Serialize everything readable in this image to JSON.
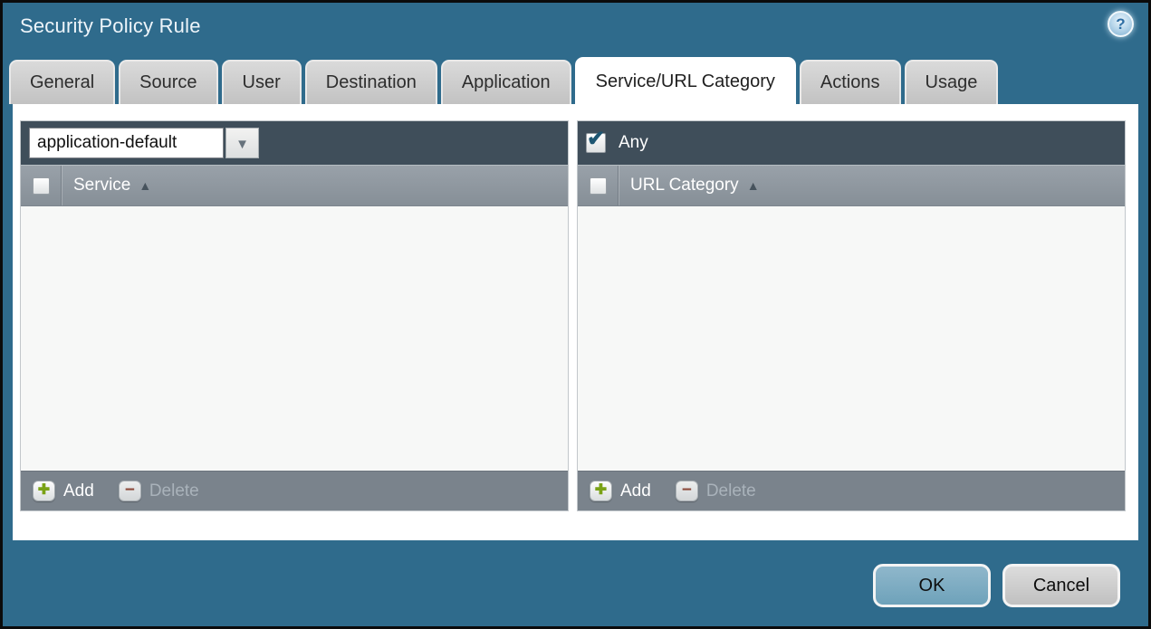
{
  "window": {
    "title": "Security Policy Rule"
  },
  "icons": {
    "help": "?",
    "check": "✔",
    "sort_asc": "▲",
    "caret_down": "▼",
    "add_plus": "✚",
    "delete_minus": "−"
  },
  "tabs": [
    {
      "label": "General",
      "active": false
    },
    {
      "label": "Source",
      "active": false
    },
    {
      "label": "User",
      "active": false
    },
    {
      "label": "Destination",
      "active": false
    },
    {
      "label": "Application",
      "active": false
    },
    {
      "label": "Service/URL Category",
      "active": true
    },
    {
      "label": "Actions",
      "active": false
    },
    {
      "label": "Usage",
      "active": false
    }
  ],
  "service_panel": {
    "dropdown": {
      "value": "application-default"
    },
    "column_header": {
      "label": "Service",
      "sort": "ascending"
    },
    "select_all_checked": false,
    "rows": [],
    "add_label": "Add",
    "delete_label": "Delete",
    "delete_enabled": false
  },
  "url_category_panel": {
    "any_checkbox": {
      "label": "Any",
      "checked": true
    },
    "column_header": {
      "label": "URL Category",
      "sort": "ascending"
    },
    "select_all_checked": false,
    "rows": [],
    "add_label": "Add",
    "delete_label": "Delete",
    "delete_enabled": false
  },
  "footer": {
    "ok_label": "OK",
    "cancel_label": "Cancel"
  },
  "colors": {
    "dialog_background": "#2f6b8c",
    "dialog_border": "#0b0b0b",
    "tab_inactive": "#cccccc",
    "tab_active": "#ffffff",
    "panel_header": "#3f4e5a",
    "column_header": "#8a939b",
    "panel_footer_bar": "#7a838c",
    "panel_body": "#f7f8f7",
    "ok_button": "#7fadc3",
    "cancel_button": "#cccccc",
    "add_icon_green": "#7aa216",
    "delete_icon_red": "#8c4a3a",
    "checkbox_check": "#1d5672"
  }
}
